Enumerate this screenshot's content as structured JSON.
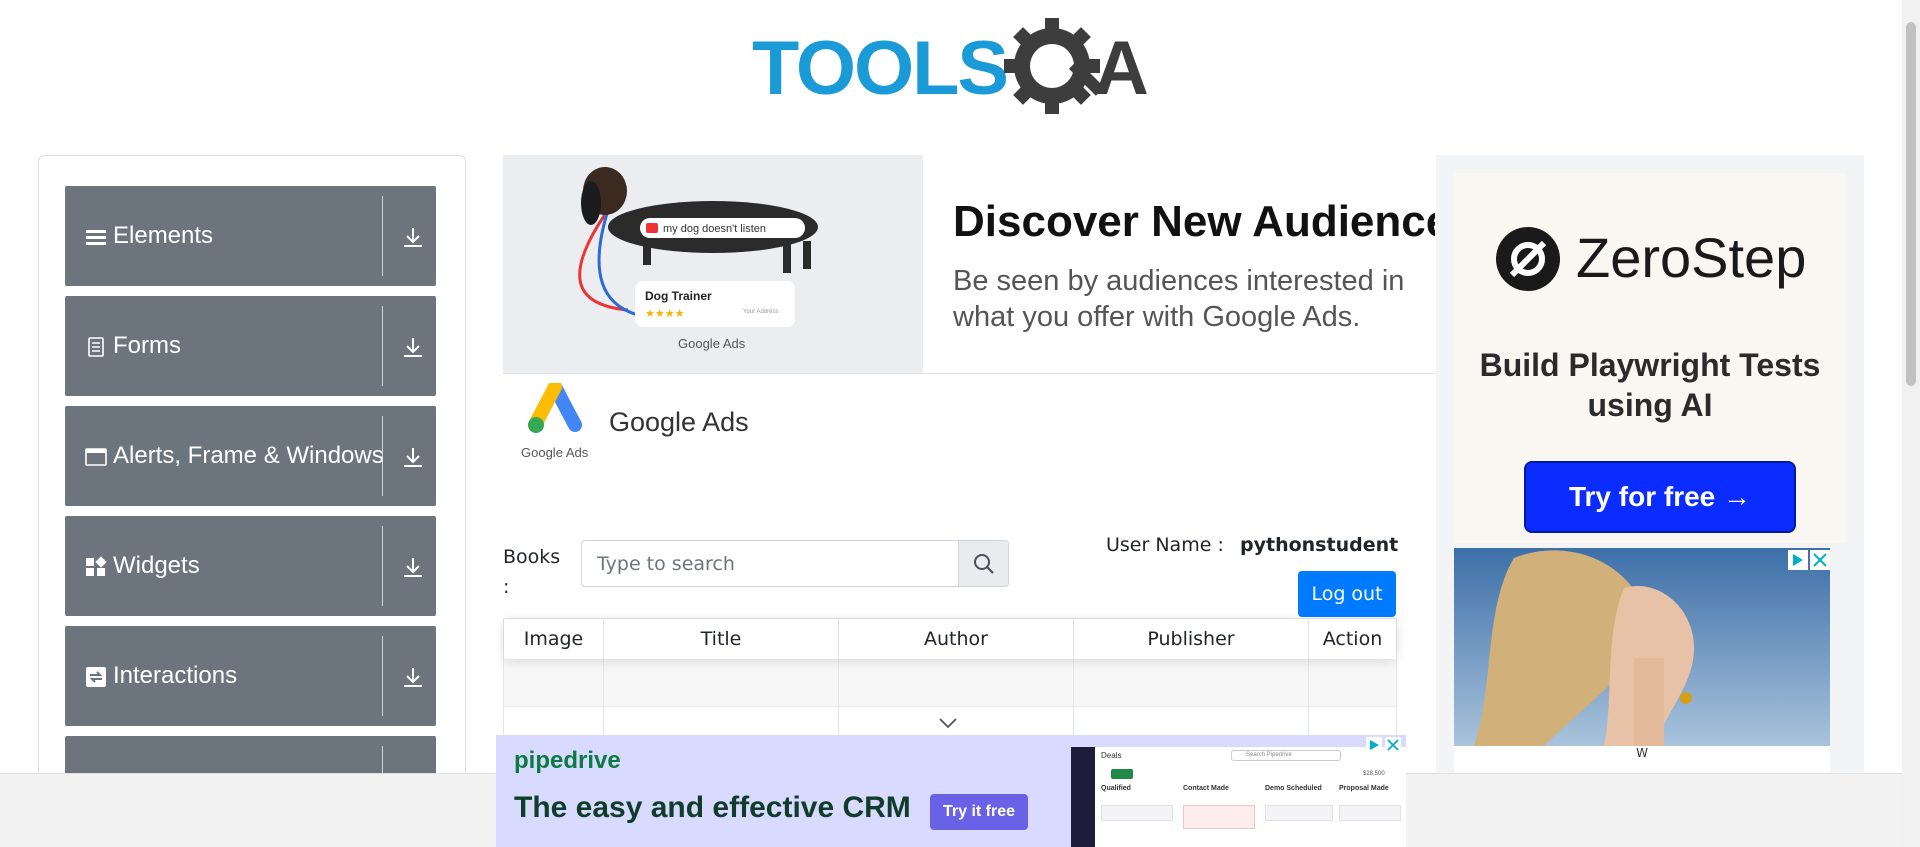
{
  "header": {
    "logo_text": "TOOLSQA"
  },
  "sidebar": {
    "groups": [
      {
        "label": "Elements",
        "icon": "menu-icon"
      },
      {
        "label": "Forms",
        "icon": "document-icon"
      },
      {
        "label": "Alerts, Frame & Windows",
        "icon": "window-icon"
      },
      {
        "label": "Widgets",
        "icon": "grid-icon"
      },
      {
        "label": "Interactions",
        "icon": "swap-icon"
      },
      {
        "label": "",
        "icon": "book-icon"
      }
    ]
  },
  "ad_top": {
    "headline": "Discover New Audiences",
    "body": "Be seen by audiences interested in what you offer with Google Ads.",
    "search_chip": "my dog doesn't listen",
    "card_title": "Dog Trainer",
    "card_address": "Your Address",
    "brand_small": "Google Ads",
    "advertiser": "Google Ads",
    "logo_caption": "Google Ads"
  },
  "books": {
    "label": "Books :",
    "search_placeholder": "Type to search",
    "user_label": "User Name :",
    "user_value": "pythonstudent",
    "logout_label": "Log out",
    "columns": [
      "Image",
      "Title",
      "Author",
      "Publisher",
      "Action"
    ]
  },
  "ad_right": {
    "brand": "ZeroStep",
    "tagline": "Build Playwright Tests using AI",
    "cta": "Try for free →",
    "caption": "W"
  },
  "ad_bottom": {
    "brand": "pipedrive",
    "headline": "The easy and effective CRM",
    "cta": "Try it free",
    "shot_title": "Deals",
    "shot_search": "Search Pipedrive",
    "shot_total": "$28,500",
    "shot_stages": [
      "Qualified",
      "Contact Made",
      "Demo Scheduled",
      "Proposal Made"
    ]
  },
  "colors": {
    "sidebar_group": "#6c757d",
    "primary_button": "#007bff",
    "logo_blue": "#1a9ad6",
    "logo_dark": "#3d3d3d",
    "zerostep_cta": "#0a2cff",
    "pipedrive_green": "#0c7a43"
  }
}
